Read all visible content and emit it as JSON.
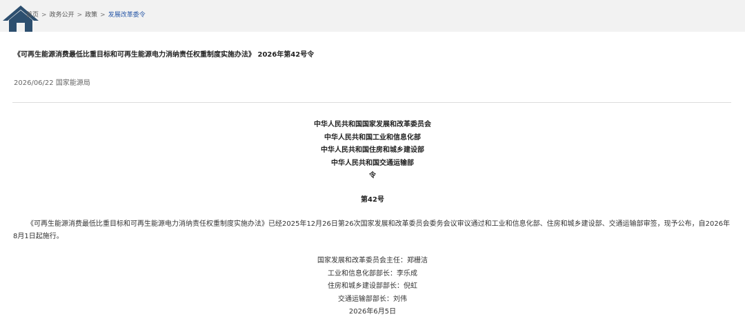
{
  "breadcrumb": {
    "home": "首页",
    "items": [
      "政务公开",
      "政策",
      "发展改革委令"
    ],
    "separator": ">"
  },
  "article": {
    "title": "《可再生能源消费最低比重目标和可再生能源电力消纳责任权重制度实施办法》 2026年第42号令",
    "date": "2026/06/22",
    "source": "国家能源局",
    "issuers": [
      "中华人民共和国国家发展和改革委员会",
      "中华人民共和国工业和信息化部",
      "中华人民共和国住房和城乡建设部",
      "中华人民共和国交通运输部",
      "令"
    ],
    "order_number": "第42号",
    "body": "《可再生能源消费最低比重目标和可再生能源电力消纳责任权重制度实施办法》已经2025年12月26日第26次国家发展和改革委员会委务会议审议通过和工业和信息化部、住房和城乡建设部、交通运输部审签，现予公布，自2026年8月1日起施行。",
    "signers": [
      "国家发展和改革委员会主任：郑栅洁",
      "工业和信息化部部长：李乐成",
      "住房和城乡建设部部长：倪虹",
      "交通运输部部长：刘伟",
      "2026年6月5日"
    ]
  },
  "colors": {
    "home_icon": "#2d4f6f",
    "breadcrumb_current": "#2b5aa8",
    "topbar_bg": "#f2f2f2"
  },
  "icons": {
    "home": "home-icon"
  }
}
